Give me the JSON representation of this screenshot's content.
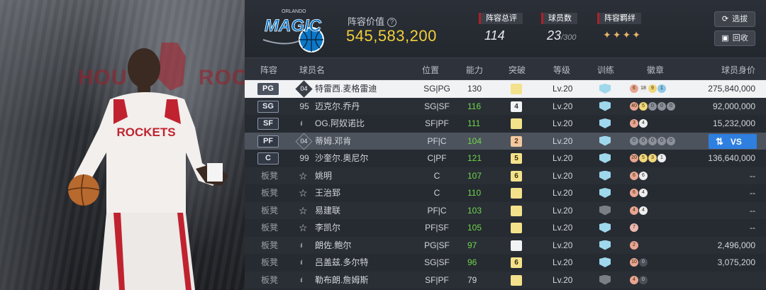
{
  "header": {
    "value_label": "阵容价值",
    "help_icon": "?",
    "value": "545,583,200",
    "stats": {
      "rating_label": "阵容总评",
      "rating_value": "114",
      "players_label": "球员数",
      "players_value": "23",
      "players_max": "/300",
      "bond_label": "阵容羁绊",
      "bond_icons": "✦✦✦✦"
    },
    "buttons": {
      "select": "选拔",
      "recycle": "回收"
    },
    "logo_text": "MAGIC",
    "logo_small": "ORLANDO"
  },
  "hero": {
    "left_text": "HOU",
    "right_text": "ROCK",
    "jersey_text": "ROCKETS"
  },
  "columns": {
    "lineup": "阵容",
    "name": "球员名",
    "position": "位置",
    "ability": "能力",
    "breakthrough": "突破",
    "level": "等级",
    "training": "训练",
    "badges": "徽章",
    "salary": "球员身价"
  },
  "rows": [
    {
      "slot": "PG",
      "jersey": "04",
      "jtype": "badge",
      "name": "特雷西.麦格雷迪",
      "position": "SG|PG",
      "ability": "130",
      "break": "",
      "btype": "yellow",
      "level": "Lv.20",
      "salary": "275,840,000",
      "state": "sel"
    },
    {
      "slot": "SG",
      "jersey": "95",
      "jtype": "plain",
      "name": "迈克尔.乔丹",
      "position": "SG|SF",
      "ability": "116",
      "break": "4",
      "btype": "white",
      "level": "Lv.20",
      "salary": "92,000,000",
      "state": "alt"
    },
    {
      "slot": "SF",
      "jersey": "ıl",
      "jtype": "sig",
      "name": "OG.阿奴诺比",
      "position": "SF|PF",
      "ability": "111",
      "break": "",
      "btype": "yellow",
      "level": "Lv.20",
      "salary": "15,232,000",
      "state": ""
    },
    {
      "slot": "PF",
      "jersey": "04",
      "jtype": "badge",
      "name": "蒂姆.邓肯",
      "position": "PF|C",
      "ability": "104",
      "break": "2",
      "btype": "orange",
      "level": "Lv.20",
      "salary": "",
      "state": "hl"
    },
    {
      "slot": "C",
      "jersey": "99",
      "jtype": "plain",
      "name": "沙奎尔.奥尼尔",
      "position": "C|PF",
      "ability": "121",
      "break": "5",
      "btype": "yellow",
      "level": "Lv.20",
      "salary": "136,640,000",
      "state": ""
    },
    {
      "slot": "板凳",
      "jersey": "☆",
      "jtype": "star",
      "name": "姚明",
      "position": "C",
      "ability": "107",
      "break": "6",
      "btype": "yellow",
      "level": "Lv.20",
      "salary": "--",
      "state": "alt"
    },
    {
      "slot": "板凳",
      "jersey": "☆",
      "jtype": "star",
      "name": "王治郅",
      "position": "C",
      "ability": "110",
      "break": "",
      "btype": "yellow",
      "level": "Lv.20",
      "salary": "--",
      "state": ""
    },
    {
      "slot": "板凳",
      "jersey": "☆",
      "jtype": "star",
      "name": "易建联",
      "position": "PF|C",
      "ability": "103",
      "break": "",
      "btype": "yellow",
      "level": "Lv.20",
      "salary": "--",
      "state": "alt"
    },
    {
      "slot": "板凳",
      "jersey": "☆",
      "jtype": "star",
      "name": "李凯尔",
      "position": "PF|SF",
      "ability": "105",
      "break": "",
      "btype": "yellow",
      "level": "Lv.20",
      "salary": "--",
      "state": ""
    },
    {
      "slot": "板凳",
      "jersey": "ıl",
      "jtype": "sig",
      "name": "朗佐.鲍尔",
      "position": "PG|SF",
      "ability": "97",
      "break": "",
      "btype": "white",
      "level": "Lv.20",
      "salary": "2,496,000",
      "state": "alt"
    },
    {
      "slot": "板凳",
      "jersey": "ıl",
      "jtype": "sig",
      "name": "吕盖兹.多尔特",
      "position": "SG|SF",
      "ability": "96",
      "break": "6",
      "btype": "yellow",
      "level": "Lv.20",
      "salary": "3,075,200",
      "state": ""
    },
    {
      "slot": "板凳",
      "jersey": "ıl",
      "jtype": "sig",
      "name": "勒布朗.詹姆斯",
      "position": "SF|PF",
      "ability": "79",
      "break": "",
      "btype": "yellow",
      "level": "Lv.20",
      "salary": "",
      "state": "alt"
    }
  ],
  "row_badges": [
    [
      [
        "d-red",
        "6"
      ],
      [
        "d-white",
        "18"
      ],
      [
        "d-gold",
        "9"
      ],
      [
        "d-blue",
        "1"
      ]
    ],
    [
      [
        "d-red",
        "40"
      ],
      [
        "d-gold",
        "5"
      ],
      [
        "d-grey",
        "0"
      ],
      [
        "d-grey",
        "0"
      ],
      [
        "d-grey",
        "0"
      ]
    ],
    [
      [
        "d-red",
        "3"
      ],
      [
        "d-white",
        "4"
      ]
    ],
    [
      [
        "d-grey",
        "0"
      ],
      [
        "d-grey",
        "0"
      ],
      [
        "d-grey",
        "0"
      ],
      [
        "d-grey",
        "0"
      ],
      [
        "d-grey",
        "0"
      ]
    ],
    [
      [
        "d-red",
        "20"
      ],
      [
        "d-gold",
        "5"
      ],
      [
        "d-gold",
        "3"
      ],
      [
        "d-white",
        "1"
      ]
    ],
    [
      [
        "d-red",
        "6"
      ],
      [
        "d-white",
        "6"
      ]
    ],
    [
      [
        "d-red",
        "6"
      ],
      [
        "d-white",
        "4"
      ]
    ],
    [
      [
        "d-red",
        "4"
      ],
      [
        "d-white",
        "4"
      ]
    ],
    [
      [
        "d-pink",
        "7"
      ]
    ],
    [
      [
        "d-red",
        "2"
      ]
    ],
    [
      [
        "d-red",
        "10"
      ],
      [
        "d-dark",
        "0"
      ]
    ],
    [
      [
        "d-red",
        "4"
      ],
      [
        "d-dark",
        "0"
      ]
    ]
  ],
  "vs_label": "VS",
  "swap_icon": "⇅",
  "colors": {
    "accent": "#2e7fe0",
    "value": "#f0cf3a",
    "ability": "#6fd64a"
  }
}
